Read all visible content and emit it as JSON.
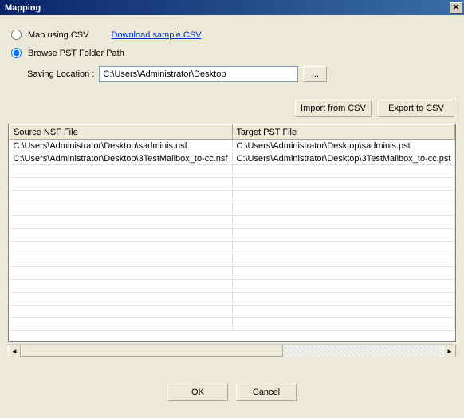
{
  "titlebar": {
    "title": "Mapping",
    "close": "✕"
  },
  "options": {
    "csv_label": "Map using CSV",
    "download_link": "Download sample CSV",
    "browse_label": "Browse PST Folder Path",
    "saving_label": "Saving Location :",
    "saving_value": "C:\\Users\\Administrator\\Desktop",
    "browse_btn": "...",
    "selected": "browse"
  },
  "actions": {
    "import": "Import from CSV",
    "export": "Export to CSV"
  },
  "table": {
    "col_source": "Source NSF File",
    "col_target": "Target PST File",
    "rows": [
      {
        "source": "C:\\Users\\Administrator\\Desktop\\sadminis.nsf",
        "target": "C:\\Users\\Administrator\\Desktop\\sadminis.pst"
      },
      {
        "source": "C:\\Users\\Administrator\\Desktop\\3TestMailbox_to-cc.nsf",
        "target": "C:\\Users\\Administrator\\Desktop\\3TestMailbox_to-cc.pst"
      }
    ],
    "scroll_left": "◄",
    "scroll_right": "►"
  },
  "footer": {
    "ok": "OK",
    "cancel": "Cancel"
  }
}
